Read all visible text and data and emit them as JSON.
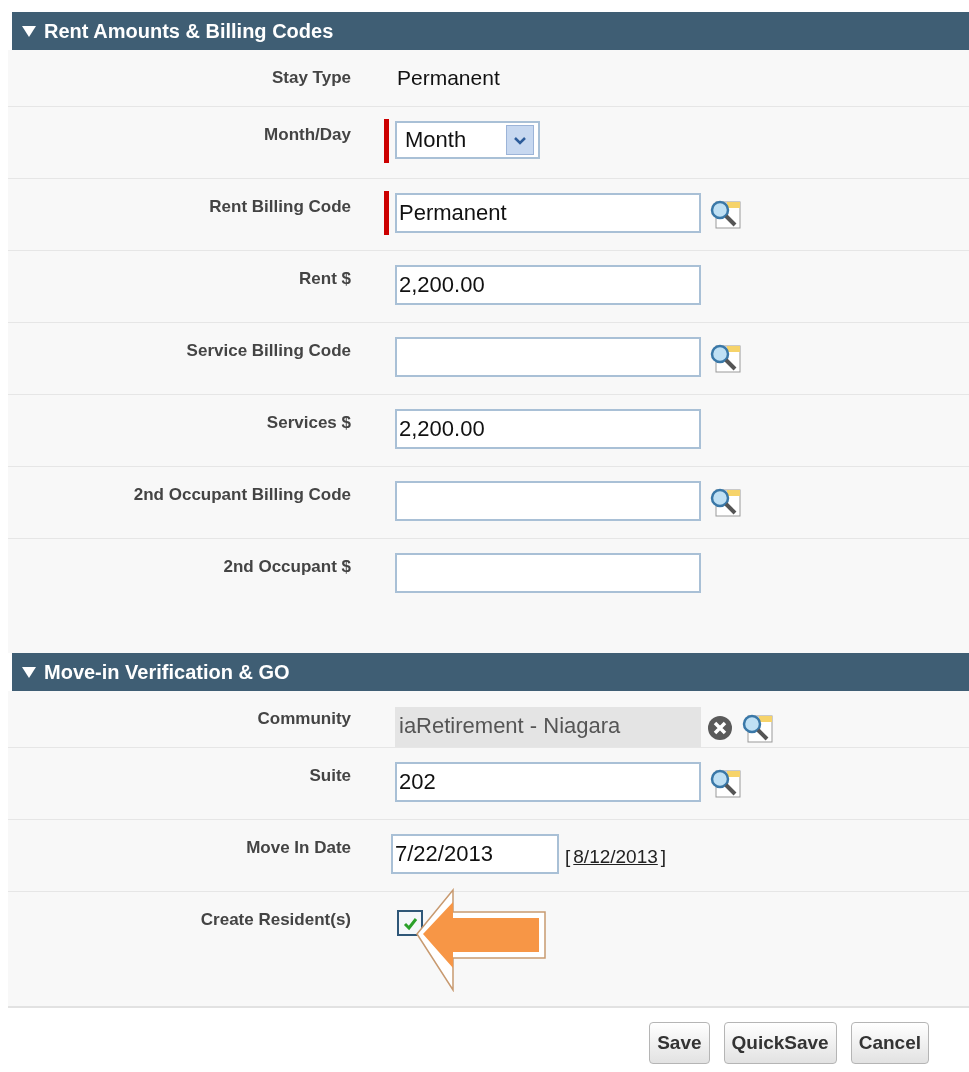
{
  "sections": [
    {
      "title": "Rent Amounts & Billing Codes",
      "expanded": true,
      "fields": [
        {
          "label": "Stay Type",
          "kind": "output",
          "value": "Permanent"
        },
        {
          "label": "Month/Day",
          "kind": "select",
          "required": true,
          "value": "Month"
        },
        {
          "label": "Rent Billing Code",
          "kind": "lookup",
          "required": true,
          "value": "Permanent"
        },
        {
          "label": "Rent $",
          "kind": "text",
          "value": "2,200.00"
        },
        {
          "label": "Service Billing Code",
          "kind": "lookup"
        },
        {
          "label": "Services $",
          "kind": "text",
          "value": "2,200.00"
        },
        {
          "label": "2nd Occupant Billing Code",
          "kind": "lookup"
        },
        {
          "label": "2nd Occupant $",
          "kind": "text"
        }
      ]
    },
    {
      "title": "Move-in Verification & GO",
      "expanded": true,
      "fields": [
        {
          "label": "Community",
          "kind": "locked-lookup",
          "value": "iaRetirement - Niagara"
        },
        {
          "label": "Suite",
          "kind": "lookup",
          "value": "202"
        },
        {
          "label": "Move In Date",
          "kind": "date",
          "value": "7/22/2013",
          "open_bracket": "[",
          "link": "8/12/2013",
          "close_bracket": "]"
        },
        {
          "label": "Create Resident(s)",
          "kind": "checkbox",
          "checked": true
        }
      ]
    }
  ],
  "buttons": [
    "Save",
    "QuickSave",
    "Cancel"
  ]
}
